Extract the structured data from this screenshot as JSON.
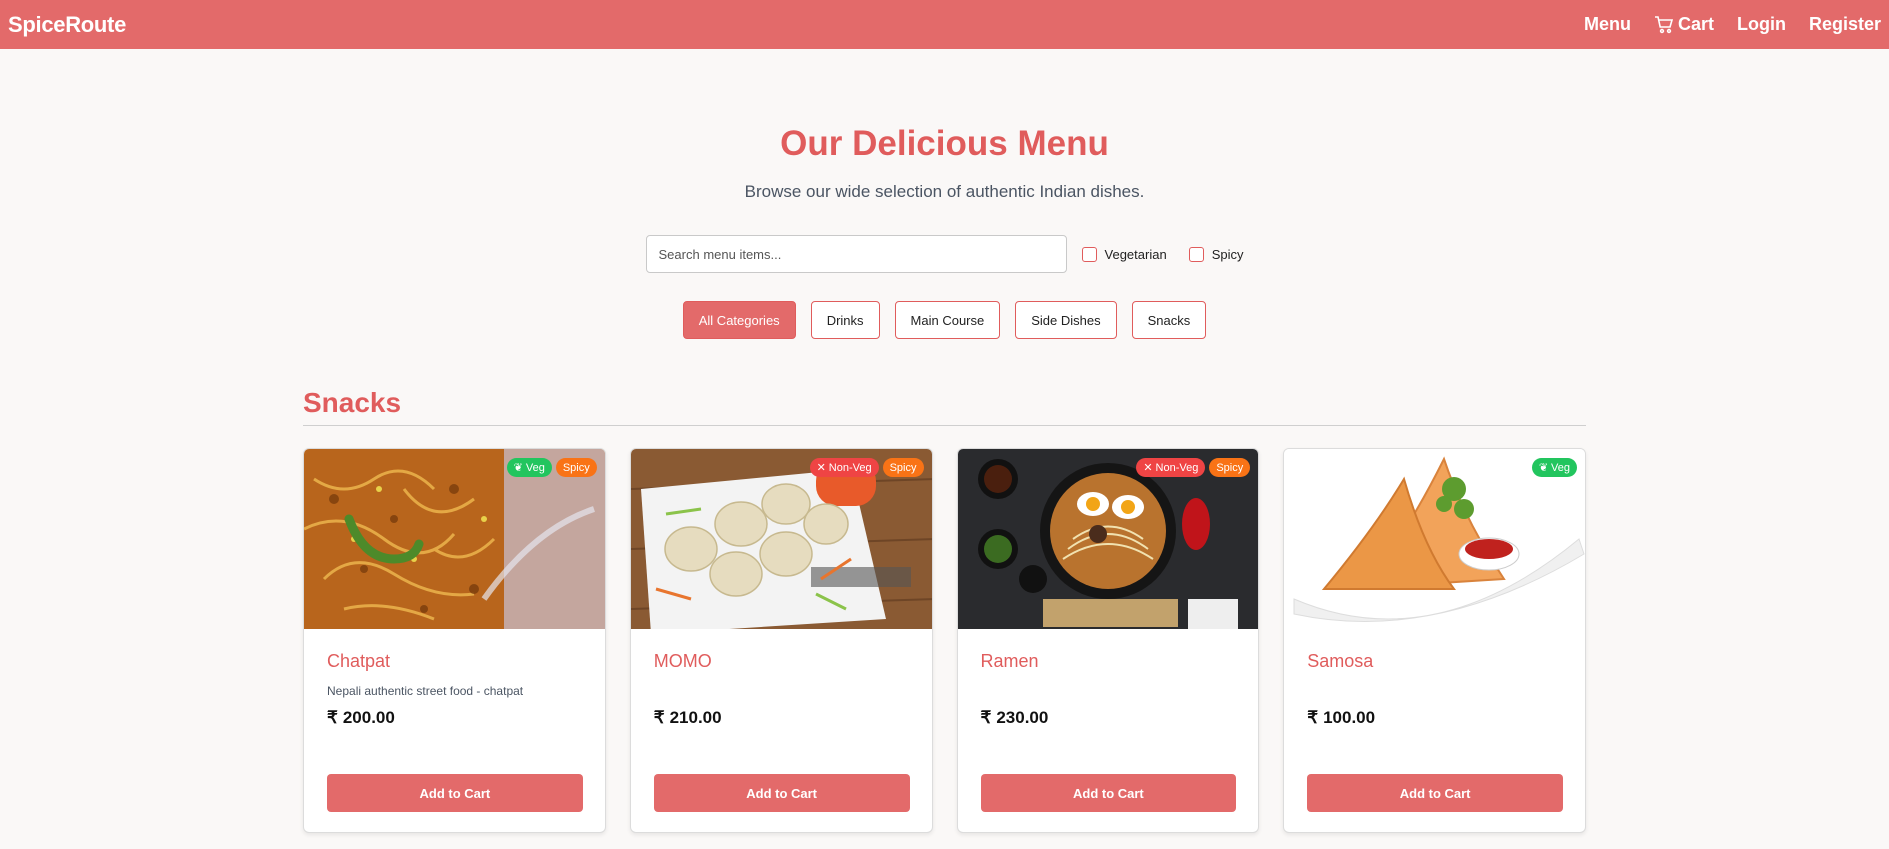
{
  "nav": {
    "brand": "SpiceRoute",
    "menu": "Menu",
    "cart": "Cart",
    "login": "Login",
    "register": "Register"
  },
  "hero": {
    "title": "Our Delicious Menu",
    "subtitle": "Browse our wide selection of authentic Indian dishes."
  },
  "filters": {
    "search_placeholder": "Search menu items...",
    "vegetarian": "Vegetarian",
    "spicy": "Spicy"
  },
  "categories": [
    "All Categories",
    "Drinks",
    "Main Course",
    "Side Dishes",
    "Snacks"
  ],
  "active_category": "All Categories",
  "section": {
    "title": "Snacks"
  },
  "items": [
    {
      "name": "Chatpat",
      "description": "Nepali authentic street food - chatpat",
      "price": "200.00",
      "currency": "₹",
      "diet": "Veg",
      "spicy": "Spicy",
      "button": "Add to Cart"
    },
    {
      "name": "MOMO",
      "description": "",
      "price": "210.00",
      "currency": "₹",
      "diet": "Non-Veg",
      "spicy": "Spicy",
      "button": "Add to Cart"
    },
    {
      "name": "Ramen",
      "description": "",
      "price": "230.00",
      "currency": "₹",
      "diet": "Non-Veg",
      "spicy": "Spicy",
      "button": "Add to Cart"
    },
    {
      "name": "Samosa",
      "description": "",
      "price": "100.00",
      "currency": "₹",
      "diet": "Veg",
      "spicy": "",
      "button": "Add to Cart"
    }
  ],
  "colors": {
    "primary": "#e36a6a",
    "title": "#e05c5c",
    "veg": "#22c55e",
    "nonveg": "#ef4444",
    "spicy": "#f97316"
  }
}
